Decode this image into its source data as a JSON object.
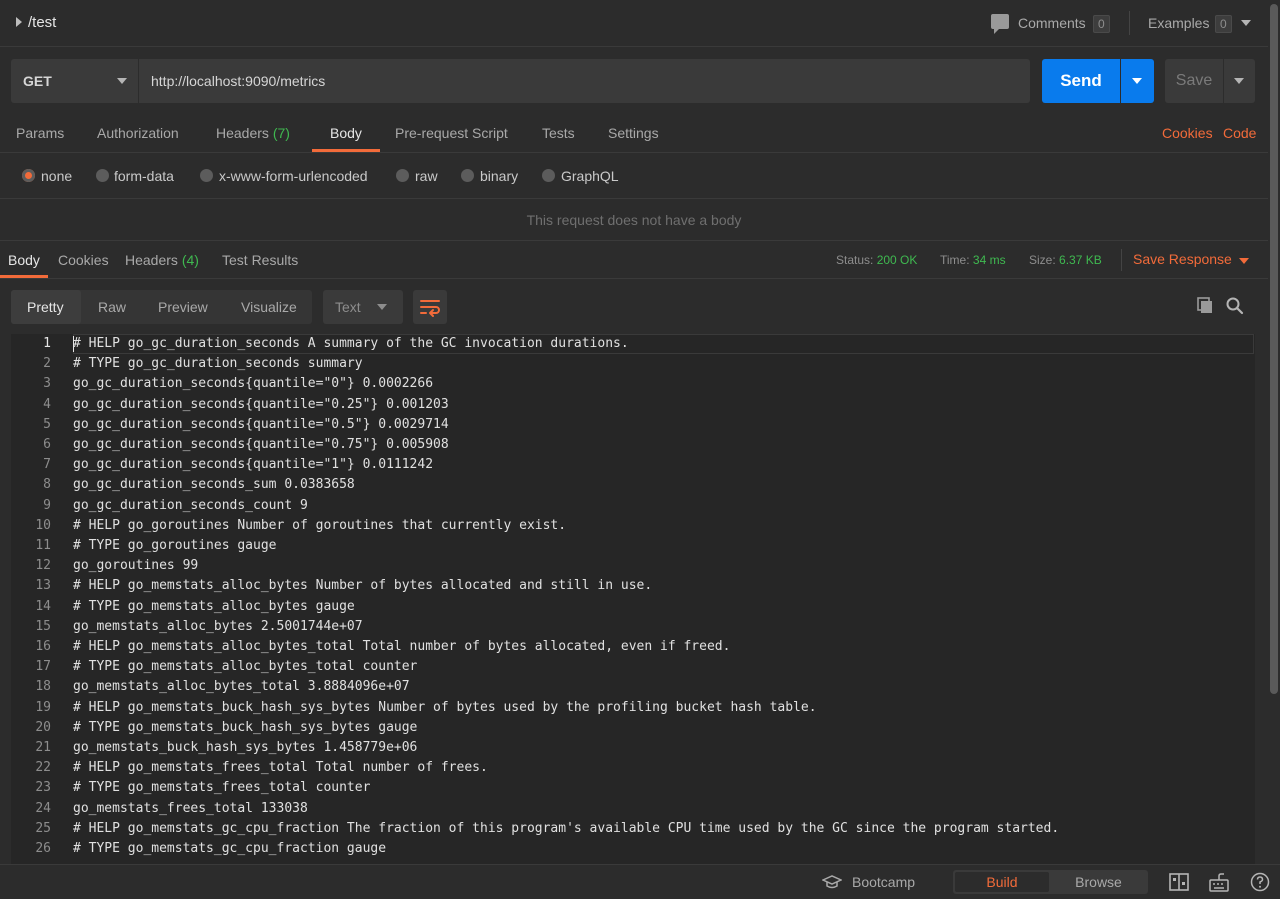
{
  "titlebar": {
    "title": "/test",
    "comments_label": "Comments",
    "comments_count": "0",
    "examples_label": "Examples",
    "examples_count": "0"
  },
  "request": {
    "method": "GET",
    "url": "http://localhost:9090/metrics",
    "send_label": "Send",
    "save_label": "Save"
  },
  "request_tabs": {
    "params": "Params",
    "authorization": "Authorization",
    "headers": "Headers",
    "headers_count": "(7)",
    "body": "Body",
    "prerequest": "Pre-request Script",
    "tests": "Tests",
    "settings": "Settings",
    "cookies": "Cookies",
    "code": "Code"
  },
  "body_types": {
    "none": "none",
    "form_data": "form-data",
    "urlencoded": "x-www-form-urlencoded",
    "raw": "raw",
    "binary": "binary",
    "graphql": "GraphQL",
    "selected": "none"
  },
  "no_body_message": "This request does not have a body",
  "response_tabs": {
    "body": "Body",
    "cookies": "Cookies",
    "headers": "Headers",
    "headers_count": "(4)",
    "test_results": "Test Results"
  },
  "response_meta": {
    "status_label": "Status:",
    "status_value": "200 OK",
    "time_label": "Time:",
    "time_value": "34 ms",
    "size_label": "Size:",
    "size_value": "6.37 KB",
    "save_response": "Save Response"
  },
  "view": {
    "pretty": "Pretty",
    "raw": "Raw",
    "preview": "Preview",
    "visualize": "Visualize",
    "format": "Text"
  },
  "code_lines": [
    "# HELP go_gc_duration_seconds A summary of the GC invocation durations.",
    "# TYPE go_gc_duration_seconds summary",
    "go_gc_duration_seconds{quantile=\"0\"} 0.0002266",
    "go_gc_duration_seconds{quantile=\"0.25\"} 0.001203",
    "go_gc_duration_seconds{quantile=\"0.5\"} 0.0029714",
    "go_gc_duration_seconds{quantile=\"0.75\"} 0.005908",
    "go_gc_duration_seconds{quantile=\"1\"} 0.0111242",
    "go_gc_duration_seconds_sum 0.0383658",
    "go_gc_duration_seconds_count 9",
    "# HELP go_goroutines Number of goroutines that currently exist.",
    "# TYPE go_goroutines gauge",
    "go_goroutines 99",
    "# HELP go_memstats_alloc_bytes Number of bytes allocated and still in use.",
    "# TYPE go_memstats_alloc_bytes gauge",
    "go_memstats_alloc_bytes 2.5001744e+07",
    "# HELP go_memstats_alloc_bytes_total Total number of bytes allocated, even if freed.",
    "# TYPE go_memstats_alloc_bytes_total counter",
    "go_memstats_alloc_bytes_total 3.8884096e+07",
    "# HELP go_memstats_buck_hash_sys_bytes Number of bytes used by the profiling bucket hash table.",
    "# TYPE go_memstats_buck_hash_sys_bytes gauge",
    "go_memstats_buck_hash_sys_bytes 1.458779e+06",
    "# HELP go_memstats_frees_total Total number of frees.",
    "# TYPE go_memstats_frees_total counter",
    "go_memstats_frees_total 133038",
    "# HELP go_memstats_gc_cpu_fraction The fraction of this program's available CPU time used by the GC since the program started.",
    "# TYPE go_memstats_gc_cpu_fraction gauge"
  ],
  "statusbar": {
    "bootcamp": "Bootcamp",
    "build": "Build",
    "browse": "Browse"
  },
  "colors": {
    "accent": "#f26b3a",
    "send": "#097bed",
    "success": "#3fb950"
  }
}
